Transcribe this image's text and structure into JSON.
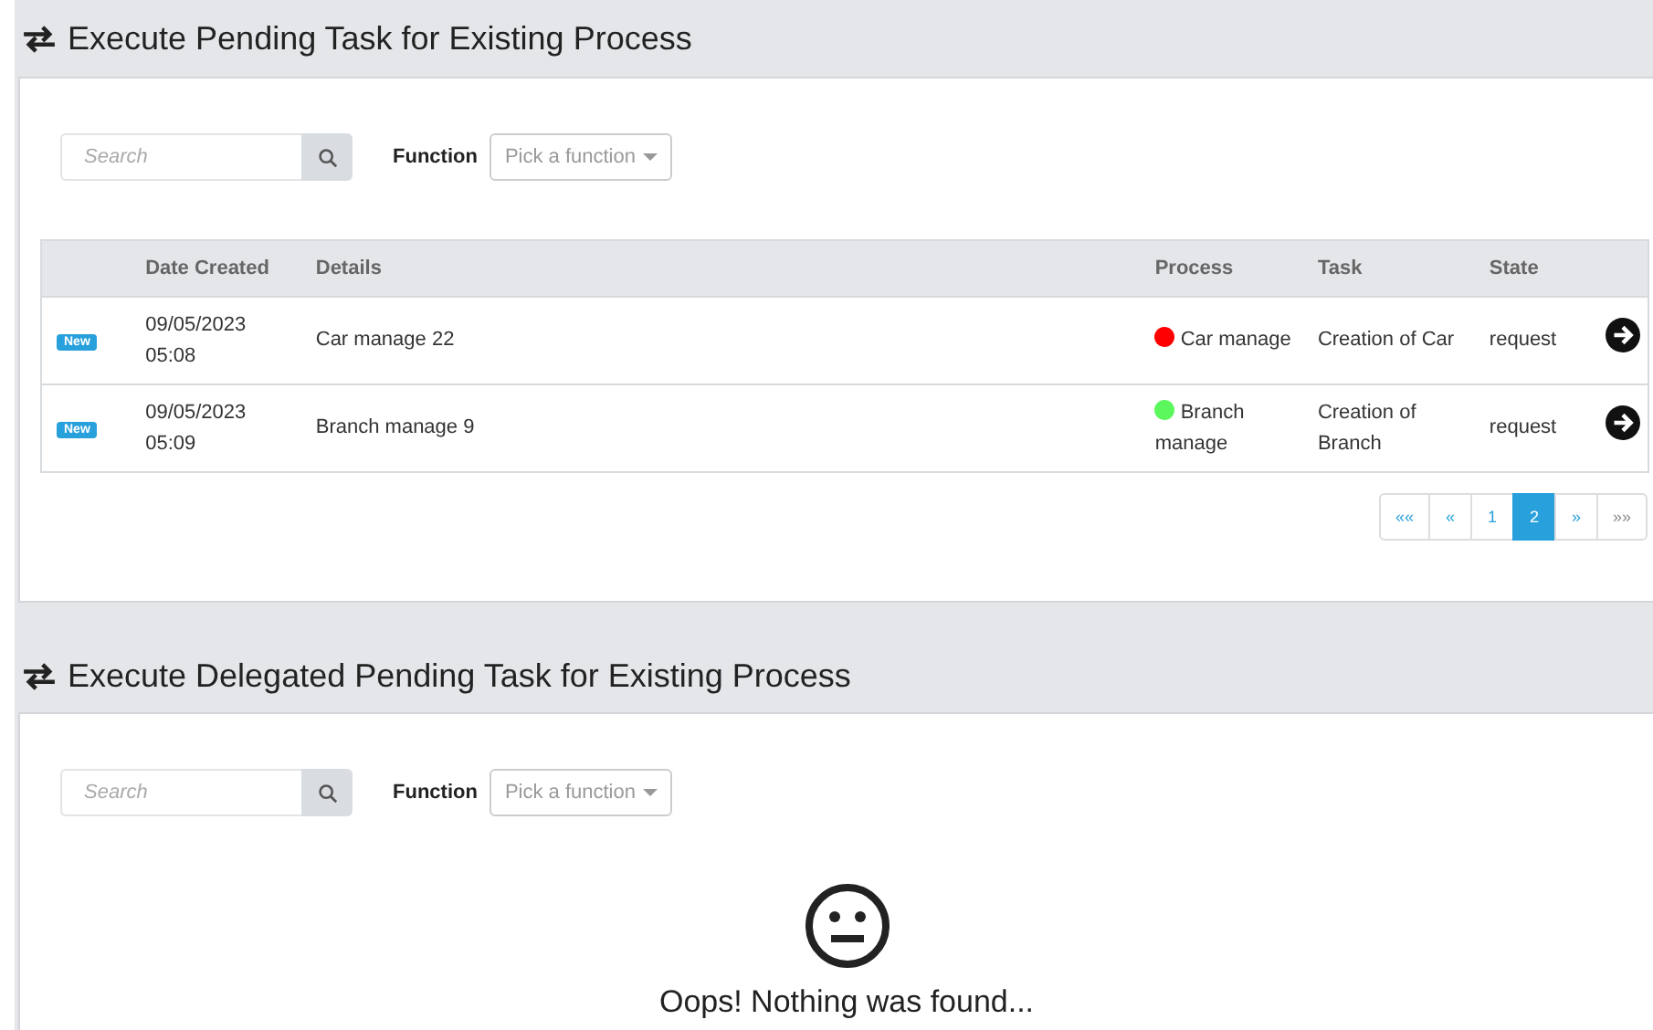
{
  "sections": [
    {
      "title": "Execute Pending Task for Existing Process",
      "search": {
        "placeholder": "Search"
      },
      "function_label": "Function",
      "function_select": "Pick a function",
      "table": {
        "columns": [
          "",
          "Date Created",
          "Details",
          "Process",
          "Task",
          "State",
          ""
        ],
        "rows": [
          {
            "badge": "New",
            "date": "09/05/2023",
            "time": "05:08",
            "details": "Car manage 22",
            "process": "Car manage",
            "color": "#ff0000",
            "task": "Creation of Car",
            "state": "request"
          },
          {
            "badge": "New",
            "date": "09/05/2023",
            "time": "05:09",
            "details": "Branch manage 9",
            "process": "Branch manage",
            "color": "#5cf75c",
            "task": "Creation of Branch",
            "state": "request"
          }
        ]
      },
      "pagination": [
        {
          "label": "««",
          "selected": false
        },
        {
          "label": "«",
          "selected": false
        },
        {
          "label": "1",
          "selected": false
        },
        {
          "label": "2",
          "selected": true
        },
        {
          "label": "»",
          "selected": false
        },
        {
          "label": "»»",
          "selected": false
        }
      ]
    },
    {
      "title": "Execute Delegated Pending Task for Existing Process",
      "search": {
        "placeholder": "Search"
      },
      "function_label": "Function",
      "function_select": "Pick a function",
      "empty_message": "Oops! Nothing was found..."
    }
  ]
}
